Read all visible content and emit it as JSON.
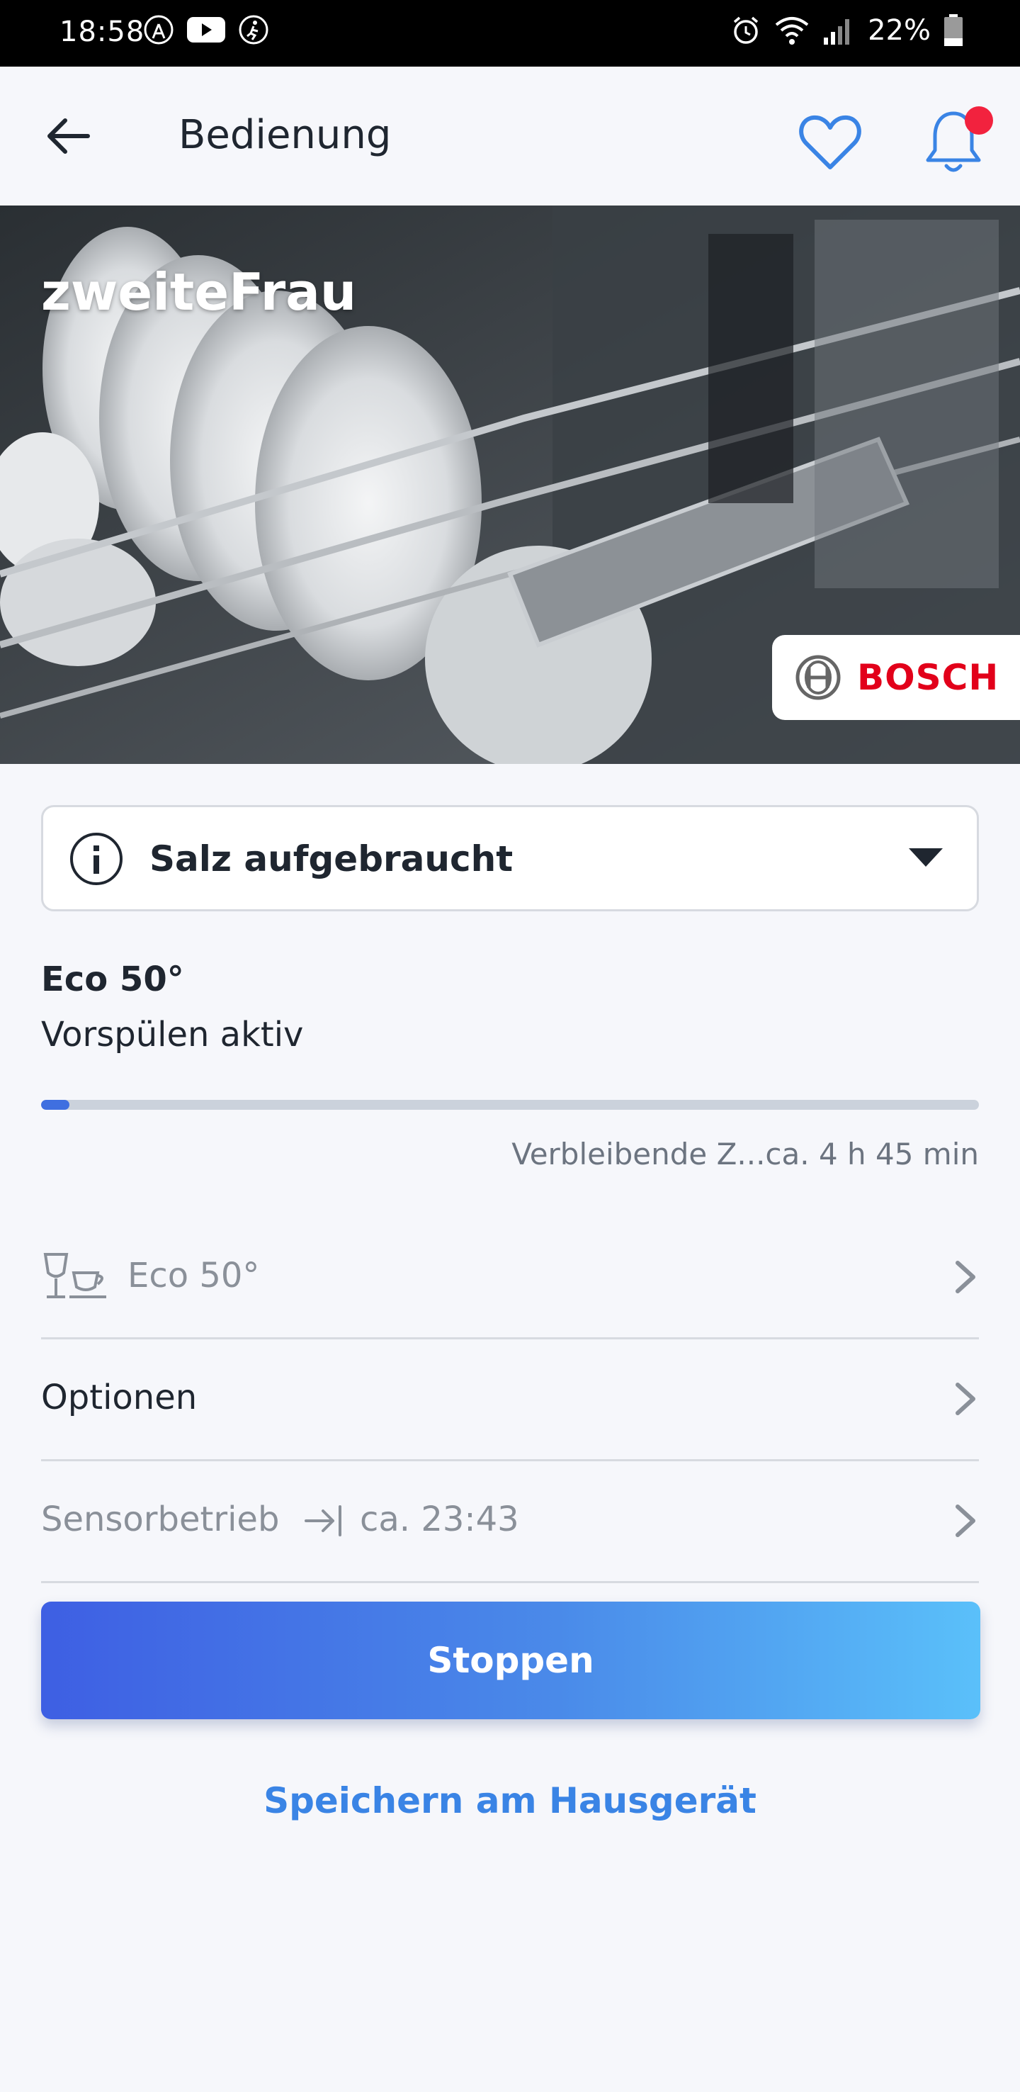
{
  "status_bar": {
    "time": "18:58",
    "battery_percent": "22%"
  },
  "app_bar": {
    "title": "Bedienung"
  },
  "hero": {
    "appliance_name": "zweiteFrau",
    "brand": "BOSCH"
  },
  "alert": {
    "text": "Salz aufgebraucht"
  },
  "program": {
    "name": "Eco 50°",
    "phase": "Vorspülen aktiv",
    "progress_fraction": 0.03,
    "remaining_text": "Verbleibende Z...ca. 4 h 45 min"
  },
  "rows": {
    "program_row": {
      "label": "Eco 50°"
    },
    "options_row": {
      "label": "Optionen"
    },
    "sensor_row": {
      "label": "Sensorbetrieb",
      "end_time": "ca. 23:43"
    }
  },
  "actions": {
    "stop_label": "Stoppen",
    "save_label": "Speichern am Hausgerät"
  },
  "colors": {
    "accent_blue": "#3a84e5",
    "notification_dot": "#f2223e",
    "brand_red": "#e2001a",
    "progress_fill": "#3f6fe0"
  }
}
